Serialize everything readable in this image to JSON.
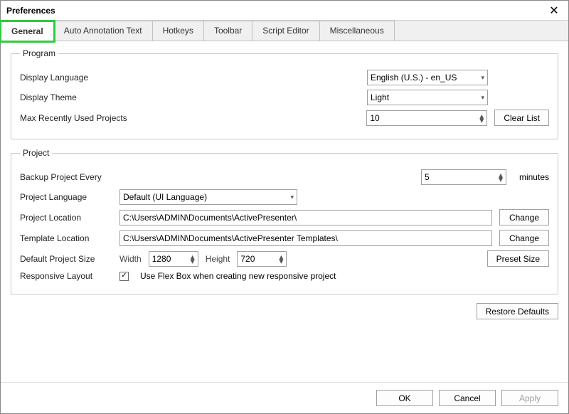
{
  "window": {
    "title": "Preferences"
  },
  "tabs": {
    "general": "General",
    "auto_annotation": "Auto Annotation Text",
    "hotkeys": "Hotkeys",
    "toolbar": "Toolbar",
    "script_editor": "Script Editor",
    "misc": "Miscellaneous"
  },
  "program": {
    "legend": "Program",
    "display_language_label": "Display Language",
    "display_language_value": "English (U.S.) - en_US",
    "display_theme_label": "Display Theme",
    "display_theme_value": "Light",
    "max_recent_label": "Max Recently Used Projects",
    "max_recent_value": "10",
    "clear_list": "Clear List"
  },
  "project": {
    "legend": "Project",
    "backup_label": "Backup Project Every",
    "backup_value": "5",
    "backup_unit": "minutes",
    "language_label": "Project Language",
    "language_value": "Default (UI Language)",
    "location_label": "Project Location",
    "location_value": "C:\\Users\\ADMIN\\Documents\\ActivePresenter\\",
    "template_label": "Template Location",
    "template_value": "C:\\Users\\ADMIN\\Documents\\ActivePresenter Templates\\",
    "change": "Change",
    "default_size_label": "Default Project Size",
    "width_label": "Width",
    "width_value": "1280",
    "height_label": "Height",
    "height_value": "720",
    "preset_size": "Preset Size",
    "responsive_label": "Responsive Layout",
    "flexbox_label": "Use Flex Box when creating new responsive project",
    "flexbox_checked": true
  },
  "restore_defaults": "Restore Defaults",
  "footer": {
    "ok": "OK",
    "cancel": "Cancel",
    "apply": "Apply"
  }
}
